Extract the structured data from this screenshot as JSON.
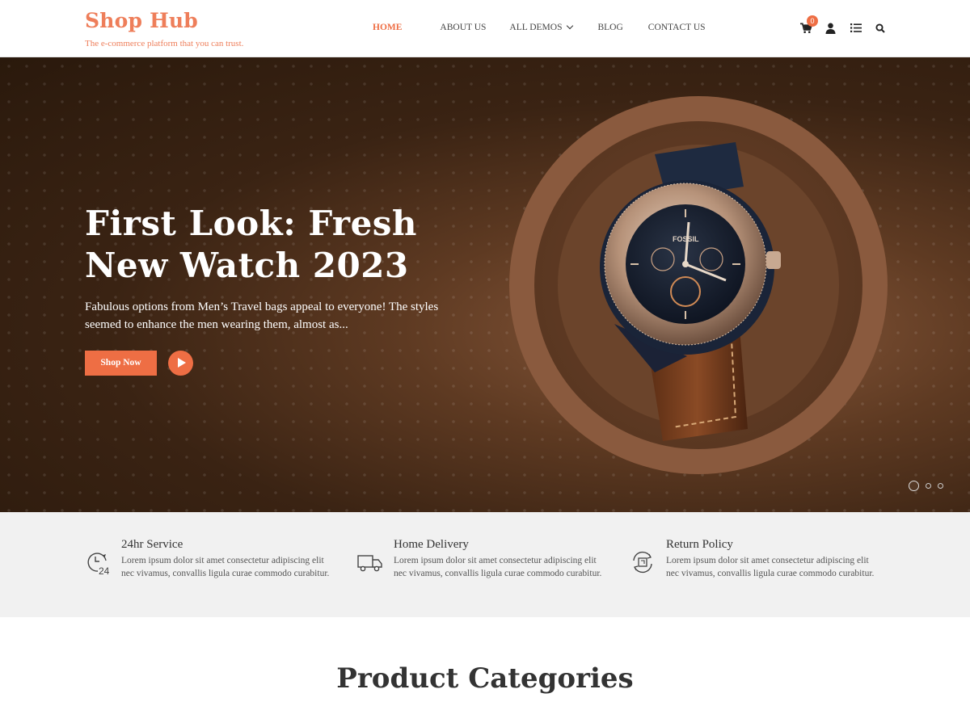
{
  "header": {
    "brand_title": "Shop Hub",
    "brand_tagline": "The e-commerce platform that you can trust.",
    "nav": [
      {
        "label": "HOME",
        "active": true
      },
      {
        "label": "ABOUT US",
        "active": false
      },
      {
        "label": "ALL DEMOS",
        "active": false
      },
      {
        "label": "BLOG",
        "active": false
      },
      {
        "label": "CONTACT US",
        "active": false
      }
    ],
    "cart_count": "0",
    "icons": [
      "cart-icon",
      "user-icon",
      "list-icon",
      "search-icon"
    ],
    "accent_color": "#ee6e44"
  },
  "hero": {
    "title": "First Look: Fresh New Watch 2023",
    "text": "Fabulous options from Men’s Travel bags appeal to everyone! The styles seemed to enhance the men wearing them, almost as...",
    "button_label": "Shop Now",
    "play_icon": "play-icon",
    "watch_brand": "FOSSIL",
    "slides_total": 3,
    "active_slide": 1
  },
  "features": [
    {
      "icon": "clock-24-icon",
      "title": "24hr Service",
      "text": "Lorem ipsum dolor sit amet consectetur adipiscing elit nec vivamus, convallis ligula curae commodo curabitur."
    },
    {
      "icon": "truck-icon",
      "title": "Home Delivery",
      "text": "Lorem ipsum dolor sit amet consectetur adipiscing elit nec vivamus, convallis ligula curae commodo curabitur."
    },
    {
      "icon": "return-icon",
      "title": "Return Policy",
      "text": "Lorem ipsum dolor sit amet consectetur adipiscing elit nec vivamus, convallis ligula curae commodo curabitur."
    }
  ],
  "section": {
    "title": "Product Categories"
  }
}
